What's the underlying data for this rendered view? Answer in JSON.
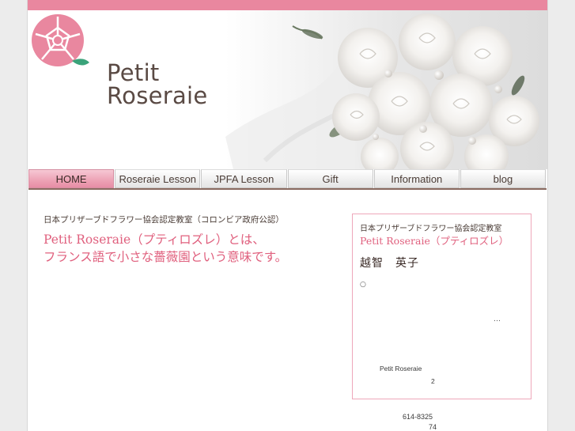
{
  "brand": {
    "line1": "Petit",
    "line2": "Roseraie",
    "logo_color": "#e9879f",
    "leaf_color": "#3aa37a"
  },
  "nav": {
    "items": [
      {
        "label": "HOME",
        "active": true
      },
      {
        "label": "Roseraie Lesson",
        "active": false
      },
      {
        "label": "JPFA Lesson",
        "active": false
      },
      {
        "label": "Gift",
        "active": false
      },
      {
        "label": "Information",
        "active": false
      },
      {
        "label": "blog",
        "active": false
      }
    ]
  },
  "main": {
    "subtitle": "日本プリザーブドフラワー協会認定教室（コロンビア政府公認）",
    "lead_line1": "Petit Roseraie（プティロズレ）とは、",
    "lead_line2": "フランス語で小さな薔薇園という意味です。"
  },
  "sidebox": {
    "cert": "日本プリザーブドフラワー協会認定教室",
    "name": "Petit Roseraie（プティロズレ）",
    "person": "越智　英子",
    "bullet": "○",
    "ellipsis": "…",
    "petit": "Petit Roseraie",
    "num": "2"
  },
  "footer": {
    "postal": "614-8325",
    "addr_num": "74"
  },
  "colors": {
    "accent_pink": "#e9879f",
    "text_pink": "#e0607e",
    "nav_active": "#eda2b5"
  }
}
